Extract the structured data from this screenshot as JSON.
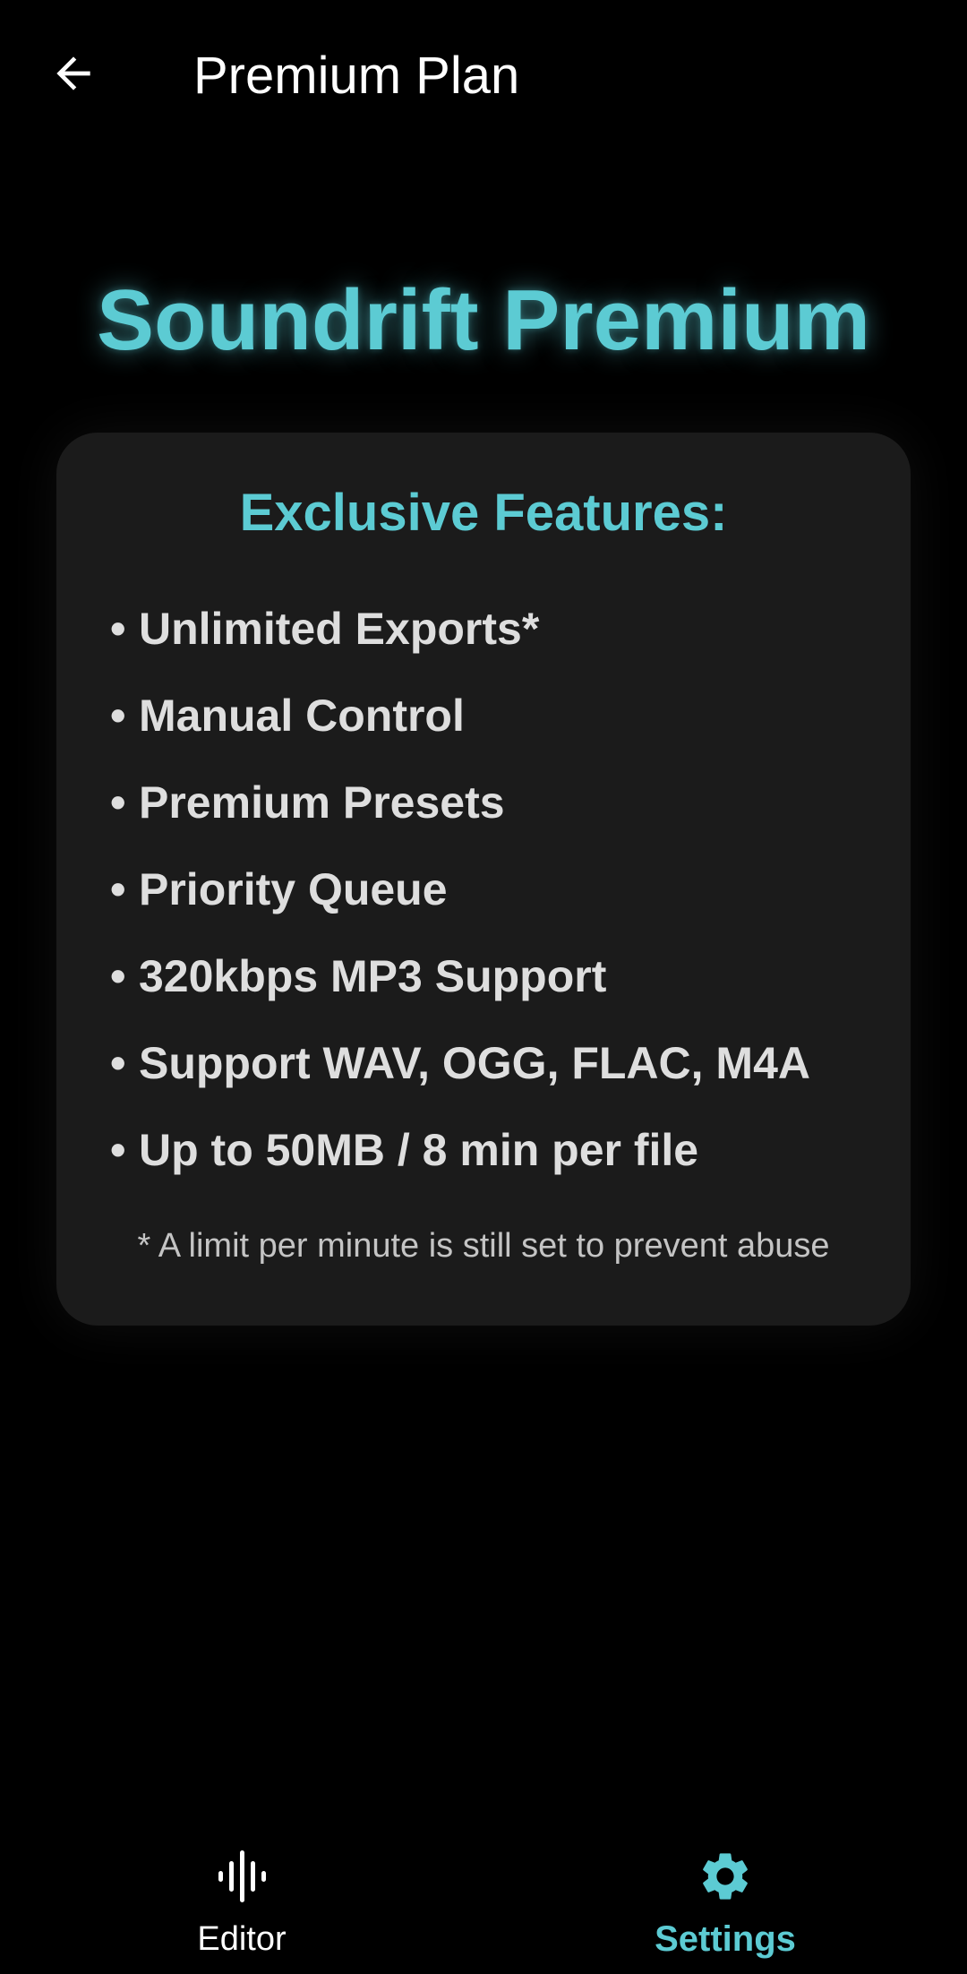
{
  "header": {
    "title": "Premium Plan",
    "back_icon": "arrow-left-icon"
  },
  "hero": {
    "title": "Soundrift Premium"
  },
  "features": {
    "heading": "Exclusive Features:",
    "bullet": "•",
    "items": [
      "Unlimited Exports*",
      "Manual Control",
      "Premium Presets",
      "Priority Queue",
      "320kbps MP3 Support",
      "Support WAV, OGG, FLAC, M4A",
      "Up to 50MB / 8 min per file"
    ],
    "footnote": "* A limit per minute is still set to prevent abuse"
  },
  "bottom_nav": {
    "items": [
      {
        "label": "Editor",
        "icon": "waveform-icon",
        "active": false
      },
      {
        "label": "Settings",
        "icon": "gear-icon",
        "active": true
      }
    ]
  },
  "colors": {
    "accent": "#5ccbd3",
    "background": "#000000",
    "card": "#1b1b1b",
    "text": "#dedede"
  }
}
